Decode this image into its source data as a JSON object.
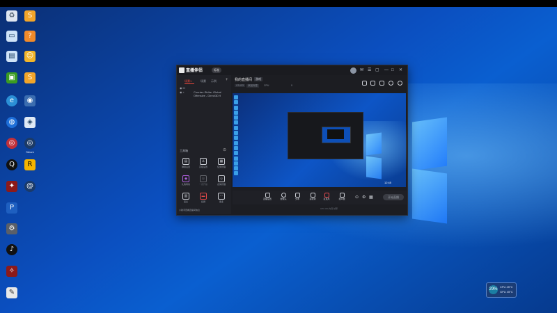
{
  "desktop": {
    "icons": [
      {
        "label": "",
        "icon": "recycle-bin-icon"
      },
      {
        "label": "",
        "icon": "ld-app-icon"
      },
      {
        "label": "",
        "icon": "this-pc-icon"
      },
      {
        "label": "",
        "icon": "help-icon"
      },
      {
        "label": "",
        "icon": "network-icon"
      },
      {
        "label": "",
        "icon": "face-app-icon"
      },
      {
        "label": "",
        "icon": "nvidia-icon"
      },
      {
        "label": "",
        "icon": "ld-app-2-icon"
      },
      {
        "label": "",
        "icon": "edge-icon"
      },
      {
        "label": "",
        "icon": "network-2-icon"
      },
      {
        "label": "",
        "icon": "web-icon"
      },
      {
        "label": "",
        "icon": "gamepad-icon"
      },
      {
        "label": "",
        "icon": "steam-icon"
      },
      {
        "label": "Steam",
        "icon": "steam-2-icon"
      },
      {
        "label": "",
        "icon": "qq-icon"
      },
      {
        "label": "",
        "icon": "rockstar-icon"
      },
      {
        "label": "",
        "icon": "app-red-icon"
      },
      {
        "label": "",
        "icon": "app-swirl-icon"
      },
      {
        "label": "",
        "icon": "ps-icon"
      },
      {
        "label": "",
        "icon": "settings-app-icon"
      },
      {
        "label": "",
        "icon": "music-icon"
      },
      {
        "label": "",
        "icon": "app-red-2-icon"
      },
      {
        "label": "",
        "icon": "app-white-icon"
      }
    ]
  },
  "app": {
    "title": "直播伴侣",
    "badge": "标准",
    "left": {
      "tabs": [
        "场景1",
        "场景",
        "示例"
      ],
      "sources": [
        "Counter-Strike: Global",
        "Offensive - Direct3D 9"
      ],
      "section": "工具箱",
      "tools": [
        {
          "label": "弹幕设置",
          "icon": "danmaku-icon"
        },
        {
          "label": "高级设置",
          "icon": "advanced-icon"
        },
        {
          "label": "任务管理",
          "icon": "task-icon"
        },
        {
          "label": "礼物特效",
          "icon": "gift-icon"
        },
        {
          "label": "一键开播",
          "icon": "start-icon"
        },
        {
          "label": "表情管理",
          "icon": "emoji-icon"
        },
        {
          "label": "连麦",
          "icon": "mic-icon"
        },
        {
          "label": "投屏",
          "icon": "cast-icon"
        },
        {
          "label": "更多",
          "icon": "more-icon"
        }
      ],
      "footer": "小助手查看直播间信息"
    },
    "right": {
      "title": "我的直播间",
      "tag": "游戏",
      "info": [
        "CS:GO",
        "添加标签",
        "CPU",
        "0"
      ],
      "toolbar": [
        {
          "label": "直播设置",
          "icon": "settings-icon"
        },
        {
          "label": "摄像头",
          "icon": "camera-icon"
        },
        {
          "label": "文本",
          "icon": "text-icon"
        },
        {
          "label": "多媒体",
          "icon": "media-icon"
        },
        {
          "label": "麦克风",
          "icon": "mic2-icon"
        },
        {
          "label": "扬声器",
          "icon": "speaker-icon"
        }
      ],
      "live_button": "开始直播",
      "status": "CPU 0%  内存  帧率"
    },
    "preview_time": "12:45"
  },
  "tray": {
    "percent": "29%",
    "line1": "CPU 45°C",
    "line2": "GPU 45°C"
  }
}
